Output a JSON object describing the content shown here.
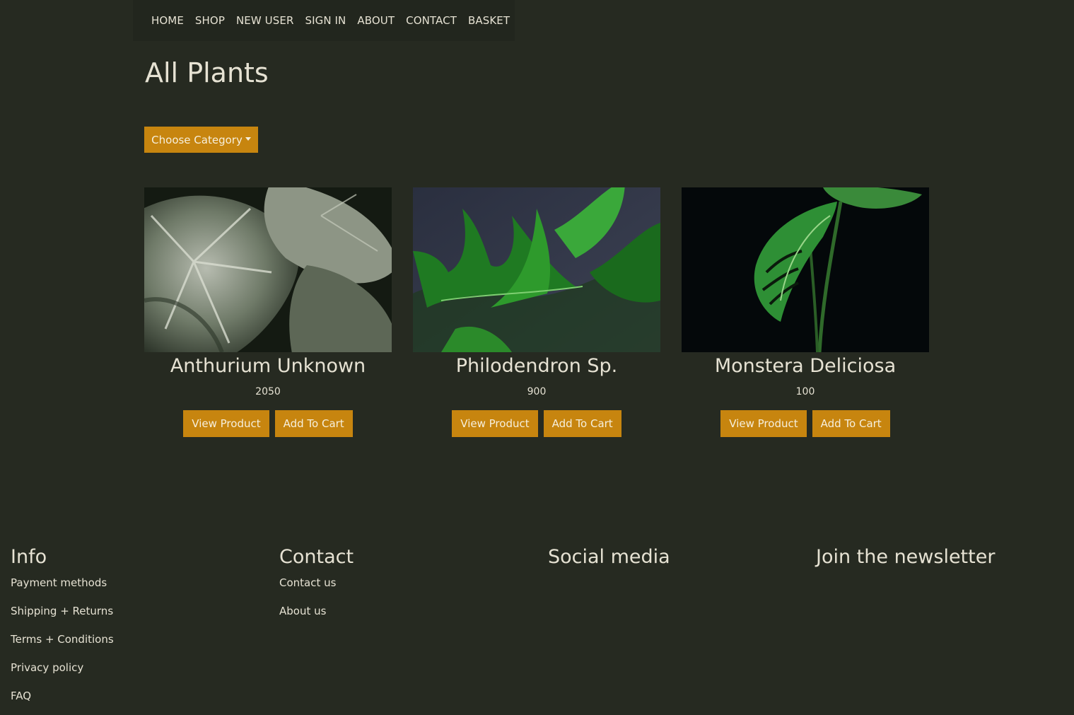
{
  "nav": {
    "items": [
      {
        "label": "HOME"
      },
      {
        "label": "SHOP"
      },
      {
        "label": "NEW USER"
      },
      {
        "label": "SIGN IN"
      },
      {
        "label": "ABOUT"
      },
      {
        "label": "CONTACT"
      },
      {
        "label": "BASKET"
      }
    ]
  },
  "page": {
    "title": "All Plants",
    "category_button": "Choose Category"
  },
  "products": [
    {
      "name": "Anthurium Unknown",
      "price": "2050",
      "view_label": "View Product",
      "cart_label": "Add To Cart",
      "image": "anthurium-leaf-photo"
    },
    {
      "name": "Philodendron Sp.",
      "price": "900",
      "view_label": "View Product",
      "cart_label": "Add To Cart",
      "image": "philodendron-leaf-photo"
    },
    {
      "name": "Monstera Deliciosa",
      "price": "100",
      "view_label": "View Product",
      "cart_label": "Add To Cart",
      "image": "monstera-leaf-photo"
    }
  ],
  "footer": {
    "info": {
      "heading": "Info",
      "links": [
        "Payment methods",
        "Shipping + Returns",
        "Terms + Conditions",
        "Privacy policy",
        "FAQ"
      ]
    },
    "contact": {
      "heading": "Contact",
      "links": [
        "Contact us",
        "About us"
      ]
    },
    "social": {
      "heading": "Social media"
    },
    "newsletter": {
      "heading": "Join the newsletter"
    }
  },
  "colors": {
    "background": "#262a21",
    "accent": "#c7850f",
    "text": "#e6e2d3"
  }
}
